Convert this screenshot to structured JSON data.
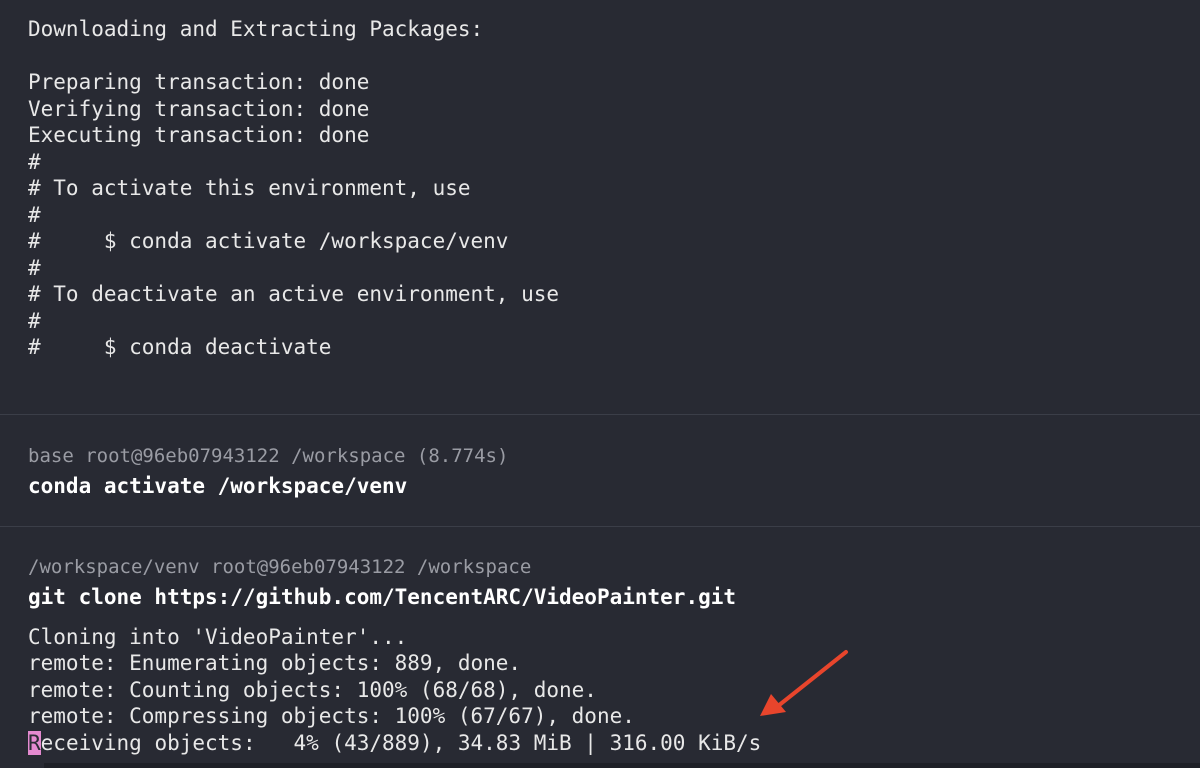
{
  "block1": {
    "lines": [
      "Downloading and Extracting Packages:",
      "",
      "Preparing transaction: done",
      "Verifying transaction: done",
      "Executing transaction: done",
      "#",
      "# To activate this environment, use",
      "#",
      "#     $ conda activate /workspace/venv",
      "#",
      "# To deactivate an active environment, use",
      "#",
      "#     $ conda deactivate"
    ]
  },
  "block2": {
    "prompt": "base root@96eb07943122 /workspace (8.774s)",
    "command": "conda activate /workspace/venv"
  },
  "block3": {
    "prompt": "/workspace/venv root@96eb07943122 /workspace",
    "command": "git clone https://github.com/TencentARC/VideoPainter.git",
    "output": [
      "Cloning into 'VideoPainter'...",
      "remote: Enumerating objects: 889, done.",
      "remote: Counting objects: 100% (68/68), done.",
      "remote: Compressing objects: 100% (67/67), done."
    ],
    "progress_first_char": "R",
    "progress_rest": "eceiving objects:   4% (43/889), 34.83 MiB | 316.00 KiB/s"
  },
  "colors": {
    "background": "#282a33",
    "cursor": "#e48ad0",
    "arrow": "#e8452c"
  },
  "icons": {
    "annotation": "red-arrow-icon"
  }
}
